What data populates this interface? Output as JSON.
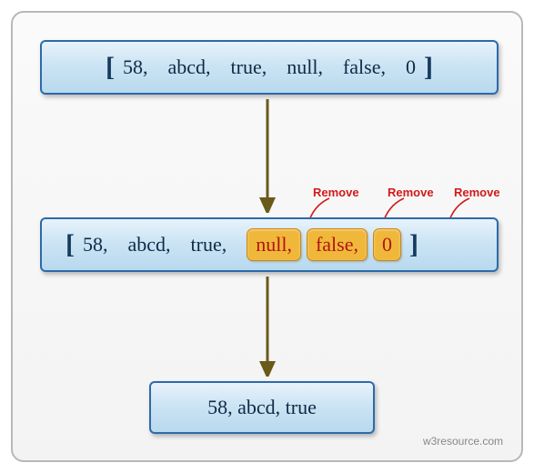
{
  "box1": {
    "items": [
      "58",
      "abcd",
      "true",
      "null",
      "false",
      "0"
    ]
  },
  "box2": {
    "plain_items": [
      "58",
      "abcd",
      "true"
    ],
    "highlighted_items": [
      "null,",
      "false,",
      "0"
    ]
  },
  "box3": {
    "text": "58,   abcd,   true"
  },
  "labels": {
    "remove": "Remove"
  },
  "watermark": "w3resource.com",
  "colors": {
    "box_border": "#2d6aa8",
    "highlight_bg": "#f0b83a",
    "highlight_text": "#b01515",
    "remove_text": "#d11a1a",
    "arrow": "#6a5a1a"
  }
}
